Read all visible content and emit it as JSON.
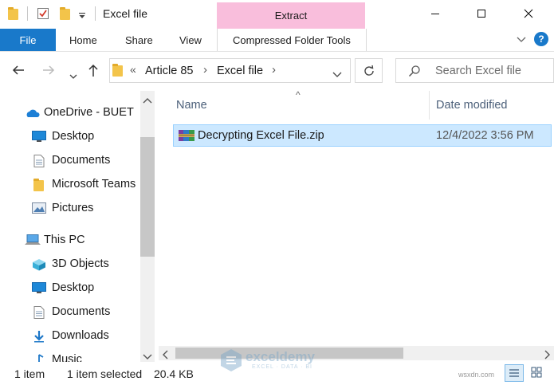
{
  "window": {
    "title": "Excel file",
    "minimize_glyph": "—",
    "maximize_glyph": "☐",
    "close_glyph": "✕"
  },
  "quick_access": {
    "icons": [
      "folder-icon",
      "properties-checkmark-icon",
      "new-folder-icon",
      "customize-dropdown-icon"
    ]
  },
  "ribbon": {
    "file_tab": "File",
    "tabs": [
      "Home",
      "Share",
      "View"
    ],
    "context_group": "Extract",
    "context_tab": "Compressed Folder Tools",
    "collapse_glyph": "﹀",
    "help_glyph": "?"
  },
  "address_bar": {
    "overflow": "«",
    "breadcrumb": [
      "Article 85",
      "Excel file"
    ],
    "separator": "›"
  },
  "search": {
    "placeholder": "Search Excel file"
  },
  "nav_pane": {
    "items": [
      {
        "label": "OneDrive - BUET",
        "icon": "onedrive-cloud-icon"
      },
      {
        "label": "Desktop",
        "icon": "desktop-icon"
      },
      {
        "label": "Documents",
        "icon": "documents-icon"
      },
      {
        "label": "Microsoft Teams",
        "icon": "folder-icon"
      },
      {
        "label": "Pictures",
        "icon": "pictures-icon"
      },
      {
        "label": "This PC",
        "icon": "this-pc-icon"
      },
      {
        "label": "3D Objects",
        "icon": "3d-objects-icon"
      },
      {
        "label": "Desktop",
        "icon": "desktop-icon"
      },
      {
        "label": "Documents",
        "icon": "documents-icon"
      },
      {
        "label": "Downloads",
        "icon": "downloads-icon"
      },
      {
        "label": "Music",
        "icon": "music-icon"
      }
    ]
  },
  "file_list": {
    "columns": [
      "Name",
      "Date modified"
    ],
    "sort_indicator": "^",
    "rows": [
      {
        "name": "Decrypting Excel File.zip",
        "date_modified": "12/4/2022 3:56 PM",
        "icon": "winrar-archive-icon",
        "selected": true
      }
    ]
  },
  "status_bar": {
    "item_count": "1 item",
    "selection": "1 item selected",
    "size": "20.4 KB"
  },
  "watermark": {
    "brand": "exceldemy",
    "tagline": "EXCEL · DATA · BI"
  },
  "corner_watermark": "wsxdn.com",
  "colors": {
    "accent": "#1979ca",
    "context_tab": "#f9bedc",
    "selection_fill": "#cce8ff",
    "selection_border": "#99d1ff"
  }
}
